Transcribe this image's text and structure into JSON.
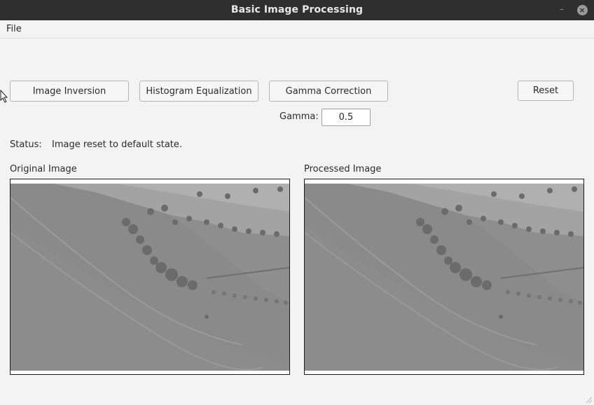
{
  "window": {
    "title": "Basic Image Processing"
  },
  "menu": {
    "file": "File"
  },
  "toolbar": {
    "image_inversion": "Image Inversion",
    "histogram_equalization": "Histogram Equalization",
    "gamma_correction": "Gamma Correction",
    "reset": "Reset"
  },
  "gamma": {
    "label": "Gamma:",
    "value": "0.5"
  },
  "status": {
    "label": "Status:",
    "text": "Image reset to default state."
  },
  "images": {
    "original_title": "Original Image",
    "processed_title": "Processed Image"
  },
  "colors": {
    "titlebar": "#2f2f2f",
    "background": "#f3f3f3",
    "image_gray": "#8c8c8c"
  }
}
